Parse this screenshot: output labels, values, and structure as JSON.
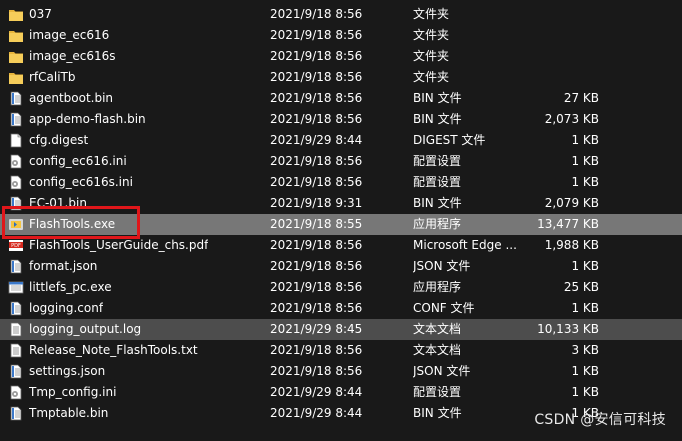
{
  "files": [
    {
      "name": "037",
      "date": "2021/9/18 8:56",
      "type": "文件夹",
      "size": "",
      "icon": "folder-icon"
    },
    {
      "name": "image_ec616",
      "date": "2021/9/18 8:56",
      "type": "文件夹",
      "size": "",
      "icon": "folder-icon"
    },
    {
      "name": "image_ec616s",
      "date": "2021/9/18 8:56",
      "type": "文件夹",
      "size": "",
      "icon": "folder-icon"
    },
    {
      "name": "rfCaliTb",
      "date": "2021/9/18 8:56",
      "type": "文件夹",
      "size": "",
      "icon": "folder-icon"
    },
    {
      "name": "agentboot.bin",
      "date": "2021/9/18 8:56",
      "type": "BIN 文件",
      "size": "27 KB",
      "icon": "file-icon"
    },
    {
      "name": "app-demo-flash.bin",
      "date": "2021/9/18 8:56",
      "type": "BIN 文件",
      "size": "2,073 KB",
      "icon": "file-icon"
    },
    {
      "name": "cfg.digest",
      "date": "2021/9/29 8:44",
      "type": "DIGEST 文件",
      "size": "1 KB",
      "icon": "blank-file-icon"
    },
    {
      "name": "config_ec616.ini",
      "date": "2021/9/18 8:56",
      "type": "配置设置",
      "size": "1 KB",
      "icon": "config-file-icon"
    },
    {
      "name": "config_ec616s.ini",
      "date": "2021/9/18 8:56",
      "type": "配置设置",
      "size": "1 KB",
      "icon": "config-file-icon"
    },
    {
      "name": "EC-01.bin",
      "date": "2021/9/18 9:31",
      "type": "BIN 文件",
      "size": "2,079 KB",
      "icon": "file-icon"
    },
    {
      "name": "FlashTools.exe",
      "date": "2021/9/18 8:55",
      "type": "应用程序",
      "size": "13,477 KB",
      "icon": "flashtools-app-icon"
    },
    {
      "name": "FlashTools_UserGuide_chs.pdf",
      "date": "2021/9/18 8:56",
      "type": "Microsoft Edge ...",
      "size": "1,988 KB",
      "icon": "pdf-icon"
    },
    {
      "name": "format.json",
      "date": "2021/9/18 8:56",
      "type": "JSON 文件",
      "size": "1 KB",
      "icon": "file-icon"
    },
    {
      "name": "littlefs_pc.exe",
      "date": "2021/9/18 8:56",
      "type": "应用程序",
      "size": "25 KB",
      "icon": "exe-icon"
    },
    {
      "name": "logging.conf",
      "date": "2021/9/18 8:56",
      "type": "CONF 文件",
      "size": "1 KB",
      "icon": "file-icon"
    },
    {
      "name": "logging_output.log",
      "date": "2021/9/29 8:45",
      "type": "文本文档",
      "size": "10,133 KB",
      "icon": "text-file-icon"
    },
    {
      "name": "Release_Note_FlashTools.txt",
      "date": "2021/9/18 8:56",
      "type": "文本文档",
      "size": "3 KB",
      "icon": "text-file-icon"
    },
    {
      "name": "settings.json",
      "date": "2021/9/18 8:56",
      "type": "JSON 文件",
      "size": "1 KB",
      "icon": "file-icon"
    },
    {
      "name": "Tmp_config.ini",
      "date": "2021/9/29 8:44",
      "type": "配置设置",
      "size": "1 KB",
      "icon": "config-file-icon"
    },
    {
      "name": "Tmptable.bin",
      "date": "2021/9/29 8:44",
      "type": "BIN 文件",
      "size": "1 KB",
      "icon": "file-icon"
    }
  ],
  "selected_index": 10,
  "hover_index": 15,
  "watermark": "CSDN @安信可科技",
  "colors": {
    "background": "#191919",
    "selected": "#777777",
    "hover": "#4d4d4d",
    "highlight_box": "#e0161a"
  }
}
